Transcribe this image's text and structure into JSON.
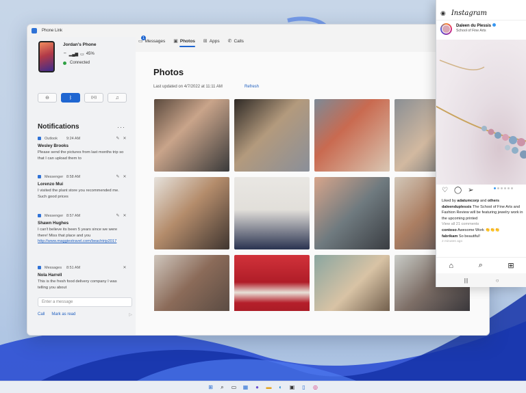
{
  "window": {
    "title": "Phone Link"
  },
  "phone": {
    "name": "Jordan's Phone",
    "battery": "45%",
    "status": "Connected"
  },
  "quick_actions": [
    {
      "icon": "do-not-disturb-icon",
      "glyph": "⊖"
    },
    {
      "icon": "bluetooth-icon",
      "glyph": "ᛒ"
    },
    {
      "icon": "audio-icon",
      "glyph": "((•))"
    },
    {
      "icon": "music-icon",
      "glyph": "♫"
    }
  ],
  "notifications": {
    "title": "Notifications",
    "more": "···",
    "items": [
      {
        "app": "Outlook",
        "time": "9:24 AM",
        "sender": "Wesley Brooks",
        "body": "Please send the pictures from last months trip so that I can upload them to"
      },
      {
        "app": "Messenger",
        "time": "8:58 AM",
        "sender": "Lorenzo Mui",
        "body": "I visited the plant store you recommended me. Such good prices"
      },
      {
        "app": "Messenger",
        "time": "8:57 AM",
        "sender": "Shawn Hughes",
        "body": "I can't believe its been 5 years since we were there! Miss that place and you",
        "link": "http://www.maggiestravel.com/beachtrip2017"
      },
      {
        "app": "Messages",
        "time": "8:51 AM",
        "sender": "Nola Harrell",
        "body": "This is the fresh food delivery company I was telling you about"
      }
    ]
  },
  "reply": {
    "placeholder": "Enter a message",
    "call": "Call",
    "mark_read": "Mark as read",
    "send": "▷"
  },
  "tabs": [
    {
      "label": "Messages",
      "icon": "messages-icon",
      "glyph": "▭",
      "badge": "1"
    },
    {
      "label": "Photos",
      "icon": "photos-icon",
      "glyph": "▣"
    },
    {
      "label": "Apps",
      "icon": "apps-icon",
      "glyph": "⊞"
    },
    {
      "label": "Calls",
      "icon": "calls-icon",
      "glyph": "✆"
    }
  ],
  "photos": {
    "title": "Photos",
    "updated": "Last updated on 4/7/2022 at 11:11 AM",
    "refresh": "Refresh"
  },
  "instagram": {
    "brand": "Instagram",
    "user": "Daleen du Plessis",
    "subtitle": "School of Fine Arts",
    "liked_by_user": "adatumcorp",
    "liked_by_rest": "others",
    "liked_prefix": "Liked by",
    "liked_and": "and",
    "caption_user": "daleenduplessis",
    "caption_text": "The School of Fine Arts and Fashion Review will be featuring jewelry work in the upcoming printed",
    "view_comments": "View all 21 comments",
    "comments": [
      {
        "user": "contoso",
        "text": "Awesome Work 👏👏👏"
      },
      {
        "user": "fabrikam",
        "text": "So beautiful!"
      }
    ],
    "time_ago": "2 minutes ago"
  },
  "colors": {
    "accent": "#1f66d1",
    "connected": "#2ea043",
    "link": "#1f5fbf"
  }
}
